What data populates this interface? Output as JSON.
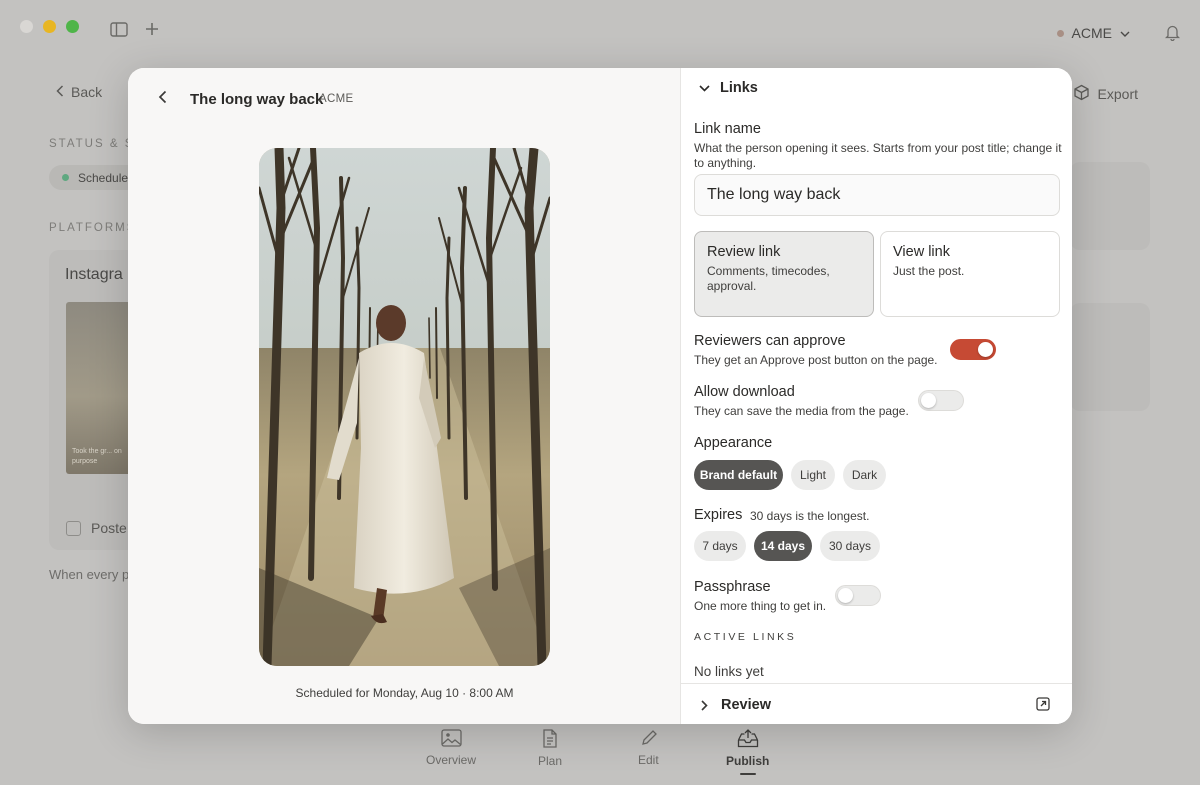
{
  "workspace": {
    "name": "ACME"
  },
  "page": {
    "back_label": "Back",
    "export_label": "Export",
    "status_section_label": "STATUS & SC",
    "status_chip_label": "Schedule",
    "platforms_label": "PLATFORMS",
    "platform_card_title": "Instagra",
    "thumb_caption": "Took the gr...  on purpose",
    "posted_label": "Poste",
    "footnote": "When every p"
  },
  "bottom_nav": [
    {
      "label": "Overview",
      "icon": "image-icon",
      "active": false
    },
    {
      "label": "Plan",
      "icon": "document-icon",
      "active": false
    },
    {
      "label": "Edit",
      "icon": "pencil-icon",
      "active": false
    },
    {
      "label": "Publish",
      "icon": "upload-tray-icon",
      "active": true
    }
  ],
  "modal": {
    "title": "The long way back",
    "brand": "ACME",
    "schedule_text": "Scheduled for Monday, Aug 10 · 8:00 AM",
    "links_section": {
      "header": "Links",
      "link_name_label": "Link name",
      "link_name_help": "What the person opening it sees. Starts from your post title; change it to anything.",
      "link_name_value": "The long way back",
      "link_types": [
        {
          "title": "Review link",
          "desc": "Comments, timecodes, approval.",
          "selected": true
        },
        {
          "title": "View link",
          "desc": "Just the post.",
          "selected": false
        }
      ],
      "reviewers_approve": {
        "label": "Reviewers can approve",
        "help": "They get an Approve post button on the page.",
        "on": true
      },
      "allow_download": {
        "label": "Allow download",
        "help": "They can save the media from the page.",
        "on": false
      },
      "appearance": {
        "label": "Appearance",
        "options": [
          "Brand default",
          "Light",
          "Dark"
        ],
        "selected": "Brand default"
      },
      "expires": {
        "label": "Expires",
        "note": "30 days is the longest.",
        "options": [
          "7 days",
          "14 days",
          "30 days"
        ],
        "selected": "14 days"
      },
      "passphrase": {
        "label": "Passphrase",
        "help": "One more thing to get in.",
        "on": false
      },
      "active_links_label": "ACTIVE LINKS",
      "active_links_empty": "No links yet"
    },
    "review_section": {
      "header": "Review"
    }
  },
  "colors": {
    "accent": "#c64a34",
    "pill_active": "#565553",
    "status_dot": "#5fa880"
  }
}
